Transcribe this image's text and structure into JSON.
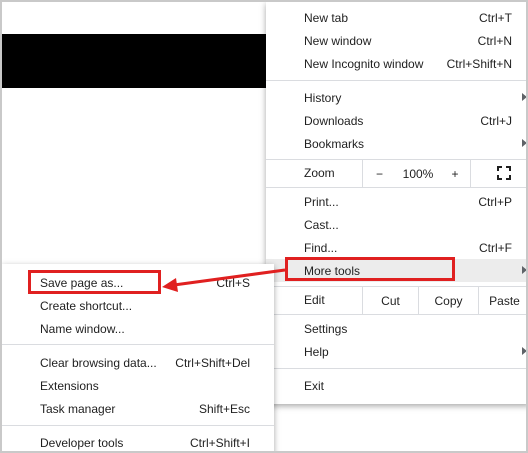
{
  "main_menu": {
    "new_tab": {
      "label": "New tab",
      "shortcut": "Ctrl+T"
    },
    "new_window": {
      "label": "New window",
      "shortcut": "Ctrl+N"
    },
    "new_incognito": {
      "label": "New Incognito window",
      "shortcut": "Ctrl+Shift+N"
    },
    "history": {
      "label": "History"
    },
    "downloads": {
      "label": "Downloads",
      "shortcut": "Ctrl+J"
    },
    "bookmarks": {
      "label": "Bookmarks"
    },
    "zoom": {
      "label": "Zoom",
      "minus": "−",
      "level": "100%",
      "plus": "+"
    },
    "print": {
      "label": "Print...",
      "shortcut": "Ctrl+P"
    },
    "cast": {
      "label": "Cast..."
    },
    "find": {
      "label": "Find...",
      "shortcut": "Ctrl+F"
    },
    "more_tools": {
      "label": "More tools"
    },
    "edit": {
      "label": "Edit",
      "cut": "Cut",
      "copy": "Copy",
      "paste": "Paste"
    },
    "settings": {
      "label": "Settings"
    },
    "help": {
      "label": "Help"
    },
    "exit": {
      "label": "Exit"
    }
  },
  "more_tools_submenu": {
    "save_page": {
      "label": "Save page as...",
      "shortcut": "Ctrl+S"
    },
    "create_shortcut": {
      "label": "Create shortcut..."
    },
    "name_window": {
      "label": "Name window..."
    },
    "clear_browsing": {
      "label": "Clear browsing data...",
      "shortcut": "Ctrl+Shift+Del"
    },
    "extensions": {
      "label": "Extensions"
    },
    "task_manager": {
      "label": "Task manager",
      "shortcut": "Shift+Esc"
    },
    "developer_tools": {
      "label": "Developer tools",
      "shortcut": "Ctrl+Shift+I"
    }
  },
  "colors": {
    "annotation": "#e02020",
    "highlight": "#ececec",
    "separator": "#dadce0"
  },
  "icons": {
    "fullscreen": "fullscreen-icon",
    "submenu_arrow": "chevron-right-icon"
  }
}
